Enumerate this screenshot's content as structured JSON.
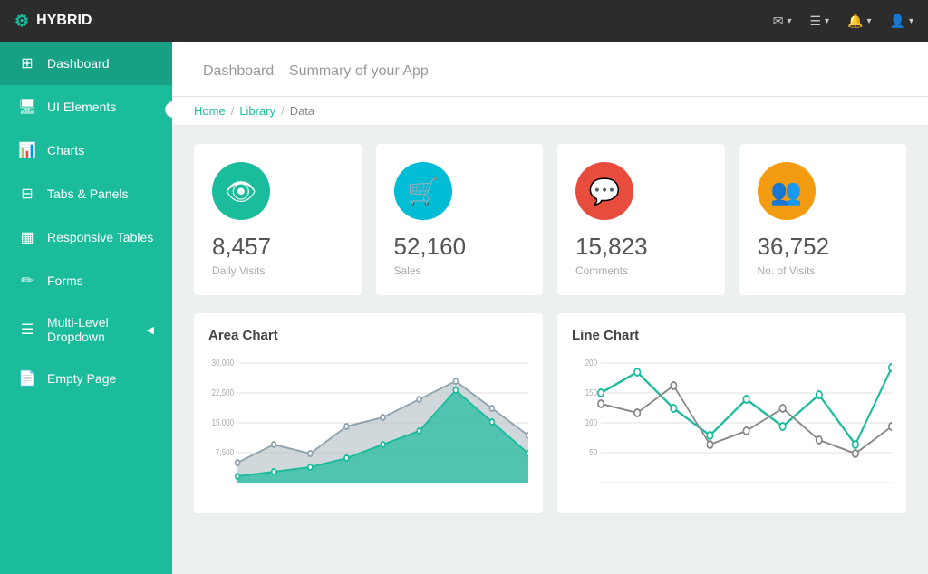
{
  "brand": {
    "icon": "⚙",
    "name": "HYBRID"
  },
  "topnav": {
    "items": [
      {
        "label": "✉",
        "caret": "▾",
        "name": "mail-btn"
      },
      {
        "label": "☰",
        "caret": "▾",
        "name": "menu-btn"
      },
      {
        "label": "🔔",
        "caret": "▾",
        "name": "notifications-btn"
      },
      {
        "label": "👤",
        "caret": "▾",
        "name": "user-btn"
      }
    ]
  },
  "sidebar": {
    "items": [
      {
        "icon": "⊞",
        "label": "Dashboard",
        "active": true,
        "name": "sidebar-item-dashboard"
      },
      {
        "icon": "🖥",
        "label": "UI Elements",
        "active": false,
        "name": "sidebar-item-ui"
      },
      {
        "icon": "📊",
        "label": "Charts",
        "active": false,
        "name": "sidebar-item-charts"
      },
      {
        "icon": "⊟",
        "label": "Tabs & Panels",
        "active": false,
        "name": "sidebar-item-tabs"
      },
      {
        "icon": "▦",
        "label": "Responsive Tables",
        "active": false,
        "name": "sidebar-item-tables"
      },
      {
        "icon": "✏",
        "label": "Forms",
        "active": false,
        "name": "sidebar-item-forms"
      },
      {
        "icon": "☰",
        "label": "Multi-Level Dropdown",
        "active": false,
        "arrow": "◀",
        "name": "sidebar-item-dropdown"
      },
      {
        "icon": "📄",
        "label": "Empty Page",
        "active": false,
        "name": "sidebar-item-empty"
      }
    ]
  },
  "page": {
    "title": "Dashboard",
    "subtitle": "Summary of your App"
  },
  "breadcrumb": {
    "items": [
      "Home",
      "Library",
      "Data"
    ]
  },
  "stat_cards": [
    {
      "icon": "👁",
      "color": "#1abc9c",
      "value": "8,457",
      "label": "Daily Visits",
      "name": "stat-card-visits"
    },
    {
      "icon": "🛒",
      "color": "#00bcd4",
      "value": "52,160",
      "label": "Sales",
      "name": "stat-card-sales"
    },
    {
      "icon": "💬",
      "color": "#e74c3c",
      "value": "15,823",
      "label": "Comments",
      "name": "stat-card-comments"
    },
    {
      "icon": "👥",
      "color": "#f39c12",
      "value": "36,752",
      "label": "No. of Visits",
      "name": "stat-card-no-visits"
    }
  ],
  "charts": [
    {
      "title": "Area Chart",
      "name": "area-chart",
      "y_labels": [
        "30,000",
        "22,500",
        "15,000",
        "7,500"
      ],
      "colors": {
        "fill1": "#1abc9c",
        "fill2": "#b0bec5"
      }
    },
    {
      "title": "Line Chart",
      "name": "line-chart",
      "y_labels": [
        "200",
        "150",
        "100",
        "50"
      ],
      "colors": {
        "line1": "#1abc9c",
        "line2": "#888"
      }
    }
  ]
}
